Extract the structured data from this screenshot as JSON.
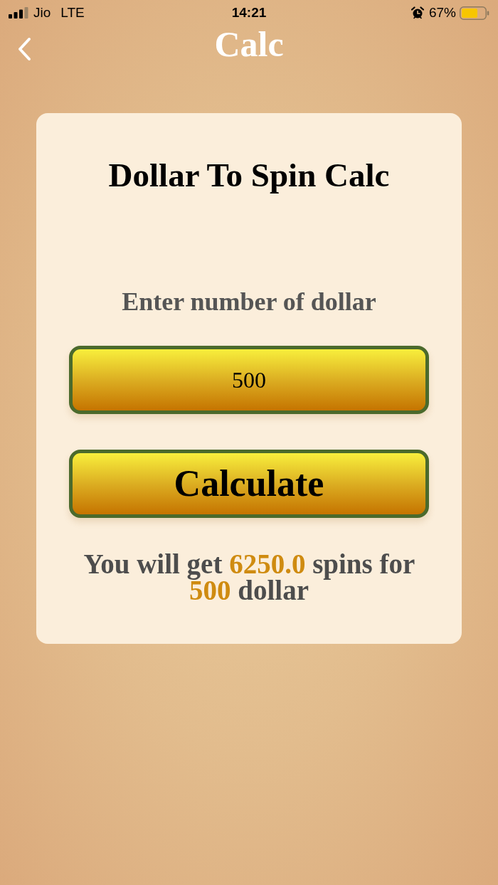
{
  "status_bar": {
    "carrier": "Jio",
    "network": "LTE",
    "time": "14:21",
    "alarm": true,
    "battery": "67%"
  },
  "nav": {
    "title": "Calc"
  },
  "card": {
    "title": "Dollar To Spin Calc",
    "input_label": "Enter number of dollar",
    "input": {
      "value": "500"
    },
    "button": {
      "label": "Calculate"
    },
    "result": [
      {
        "kind": "plain",
        "text": "You will get"
      },
      {
        "kind": "value",
        "text": "6250.0"
      },
      {
        "kind": "plain",
        "text": "spins for"
      },
      {
        "kind": "value",
        "text": "500"
      },
      {
        "kind": "plain",
        "text": "dollar"
      }
    ]
  }
}
